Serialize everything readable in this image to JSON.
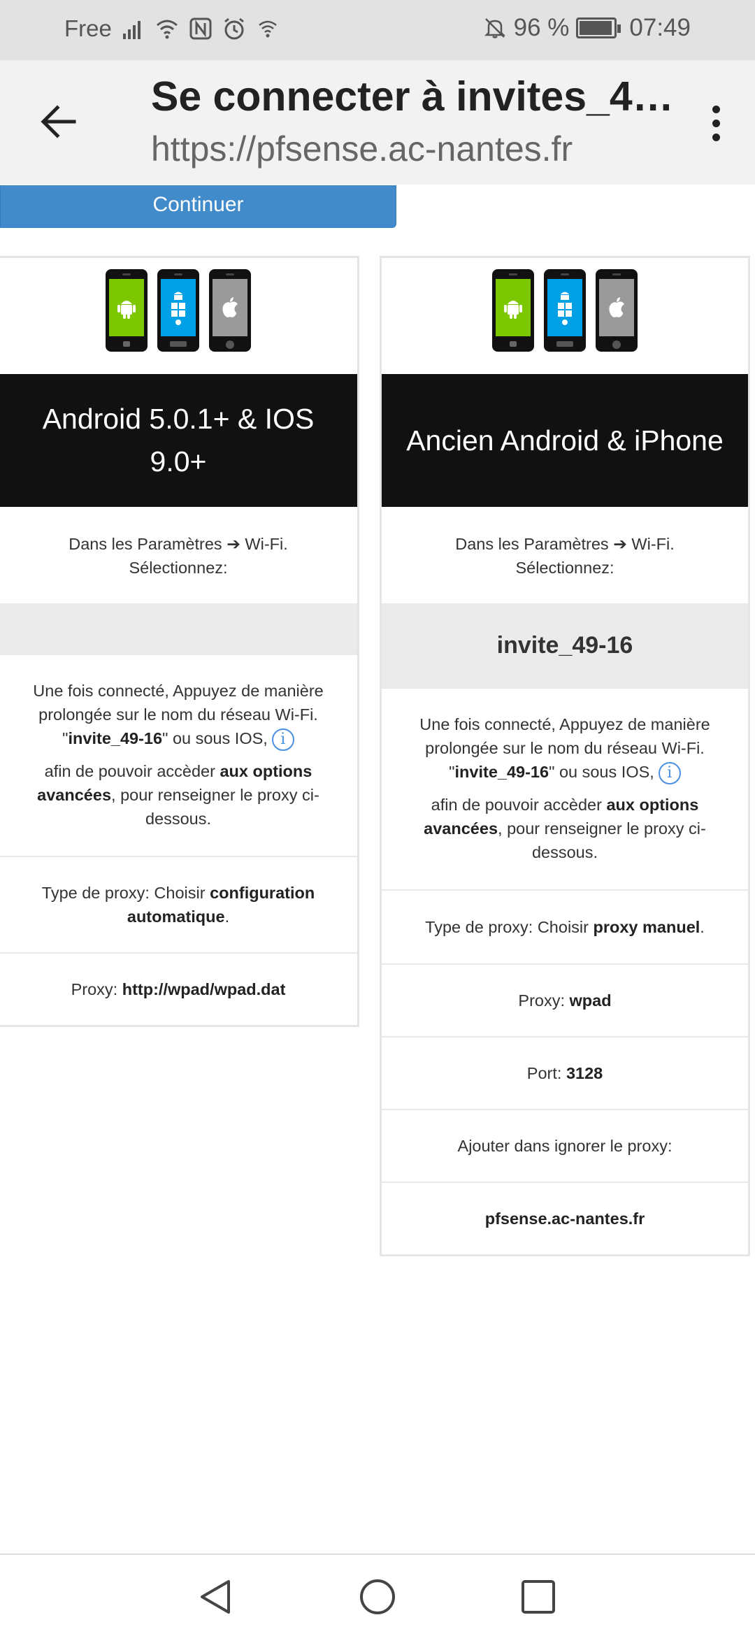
{
  "status_bar": {
    "carrier": "Free",
    "battery": "96 %",
    "battery_level": 0.96,
    "time": "07:49",
    "icons": [
      "signal-icon",
      "wifi-icon",
      "nfc-icon",
      "alarm-icon",
      "hotspot-icon",
      "bell-off-icon",
      "battery-icon"
    ]
  },
  "toolbar": {
    "title": "Se connecter à invites_4…",
    "url": "https://pfsense.ac-nantes.fr"
  },
  "continue_button": "Continuer",
  "cards": {
    "left": {
      "header": "Android 5.0.1+ & IOS 9.0+",
      "instructions_line1": "Dans les Paramètres ➔ Wi-Fi.",
      "instructions_line2": "Sélectionnez:",
      "network_name": "",
      "info_text1": "Une fois connecté, Appuyez de manière prolongée sur le nom du réseau Wi-Fi.",
      "info_quote_open": "\"",
      "info_network": "invite_49-16",
      "info_quote_rest": "\" ou sous IOS,",
      "info_text2": "afin de pouvoir accèder ",
      "info_text2_bold": "aux options avancées",
      "info_text2_end": ", pour renseigner le proxy ci-dessous.",
      "proxy_type_label": "Type de proxy: Choisir ",
      "proxy_type_value": "configuration automatique",
      "proxy_type_end": ".",
      "proxy_label": "Proxy: ",
      "proxy_value": "http://wpad/wpad.dat"
    },
    "right": {
      "header": "Ancien Android & iPhone",
      "instructions_line1": "Dans les Paramètres ➔ Wi-Fi.",
      "instructions_line2": "Sélectionnez:",
      "network_name": "invite_49-16",
      "info_text1": "Une fois connecté, Appuyez de manière prolongée sur le nom du réseau Wi-Fi.",
      "info_quote_open": "\"",
      "info_network": "invite_49-16",
      "info_quote_rest": "\" ou sous IOS,",
      "info_text2": "afin de pouvoir accèder ",
      "info_text2_bold": "aux options avancées",
      "info_text2_end": ", pour renseigner le proxy ci-dessous.",
      "proxy_type_label": "Type de proxy: Choisir ",
      "proxy_type_value": "proxy manuel",
      "proxy_type_end": ".",
      "proxy_label": "Proxy: ",
      "proxy_value": "wpad",
      "port_label": "Port: ",
      "port_value": "3128",
      "ignore_label": "Ajouter dans ignorer le proxy:",
      "ignore_value": "pfsense.ac-nantes.fr"
    }
  },
  "colors": {
    "android_green": "#7cc700",
    "windows_blue": "#00a0e6",
    "apple_gray": "#9a9a9a",
    "button_blue": "#428bca",
    "info_blue": "#4a90e2"
  }
}
